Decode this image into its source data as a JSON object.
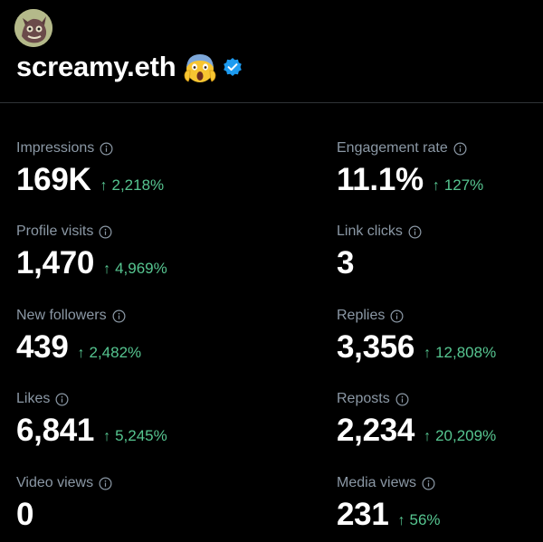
{
  "profile": {
    "display_name": "screamy.eth",
    "emoji_icon": "screaming-face-emoji-icon",
    "verified_icon": "verified-badge-icon",
    "verified_color": "#1d9bf0"
  },
  "colors": {
    "background": "#000000",
    "label": "#8b98a5",
    "value": "#ffffff",
    "positive_change": "#56c590",
    "divider": "#2f3336"
  },
  "metrics": {
    "impressions": {
      "label": "Impressions",
      "value": "169K",
      "change": "2,218%"
    },
    "engagement_rate": {
      "label": "Engagement rate",
      "value": "11.1%",
      "change": "127%"
    },
    "profile_visits": {
      "label": "Profile visits",
      "value": "1,470",
      "change": "4,969%"
    },
    "link_clicks": {
      "label": "Link clicks",
      "value": "3"
    },
    "new_followers": {
      "label": "New followers",
      "value": "439",
      "change": "2,482%"
    },
    "replies": {
      "label": "Replies",
      "value": "3,356",
      "change": "12,808%"
    },
    "likes": {
      "label": "Likes",
      "value": "6,841",
      "change": "5,245%"
    },
    "reposts": {
      "label": "Reposts",
      "value": "2,234",
      "change": "20,209%"
    },
    "video_views": {
      "label": "Video views",
      "value": "0"
    },
    "media_views": {
      "label": "Media views",
      "value": "231",
      "change": "56%"
    }
  },
  "icons": {
    "info": "info-circle-icon",
    "arrow": "arrow-up-icon",
    "arrow_glyph": "↑"
  }
}
